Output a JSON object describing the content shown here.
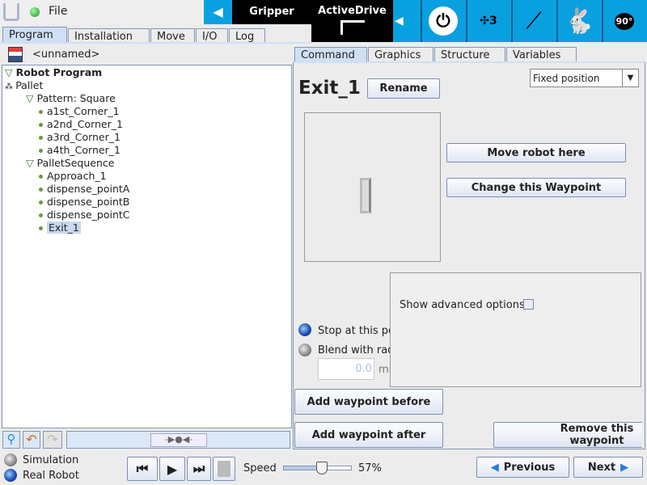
{
  "header": {
    "menu_label": "File",
    "gripper_label": "Gripper",
    "activedrive_label": "ActiveDrive",
    "icons": [
      "ur-logo-icon",
      "status-led-icon",
      "collapse-left-icon",
      "power-icon",
      "freedrive-3-icon",
      "robot-arm-no-teach-icon",
      "rabbit-speed-icon",
      "robot-90-degree-icon"
    ],
    "accent": "#09a0e0"
  },
  "main_tabs": [
    {
      "label": "Program"
    },
    {
      "label": "Installation"
    },
    {
      "label": "Move"
    },
    {
      "label": "I/O"
    },
    {
      "label": "Log"
    }
  ],
  "program_name": "<unnamed>",
  "tree": [
    {
      "label": "Robot Program",
      "level": 0,
      "type": "root"
    },
    {
      "label": "Pallet",
      "level": 0,
      "type": "pallet"
    },
    {
      "label": "Pattern: Square",
      "level": 1,
      "type": "folder"
    },
    {
      "label": "a1st_Corner_1",
      "level": 2,
      "type": "point"
    },
    {
      "label": "a2nd_Corner_1",
      "level": 2,
      "type": "point"
    },
    {
      "label": "a3rd_Corner_1",
      "level": 2,
      "type": "point"
    },
    {
      "label": "a4th_Corner_1",
      "level": 2,
      "type": "point"
    },
    {
      "label": "PalletSequence",
      "level": 1,
      "type": "folder"
    },
    {
      "label": "Approach_1",
      "level": 2,
      "type": "point"
    },
    {
      "label": "dispense_pointA",
      "level": 2,
      "type": "point"
    },
    {
      "label": "dispense_pointB",
      "level": 2,
      "type": "point"
    },
    {
      "label": "dispense_pointC",
      "level": 2,
      "type": "point"
    },
    {
      "label": "Exit_1",
      "level": 2,
      "type": "point",
      "selected": true
    }
  ],
  "sub_tabs": [
    {
      "label": "Command"
    },
    {
      "label": "Graphics"
    },
    {
      "label": "Structure"
    },
    {
      "label": "Variables"
    }
  ],
  "command": {
    "title": "Exit_1",
    "rename": "Rename",
    "position_type": "Fixed position",
    "move_here": "Move robot here",
    "change_waypoint": "Change this Waypoint",
    "show_advanced": "Show advanced options",
    "stop_label": "Stop at this point",
    "blend_label": "Blend with radius",
    "blend_value": "0.0",
    "blend_unit": "mm",
    "add_before": "Add waypoint before",
    "add_after": "Add waypoint after",
    "remove": "Remove this waypoint"
  },
  "footer": {
    "simulation": "Simulation",
    "real_robot": "Real Robot",
    "speed_label": "Speed",
    "speed_percent": 57,
    "speed_text": "57%",
    "previous": "Previous",
    "next": "Next"
  }
}
